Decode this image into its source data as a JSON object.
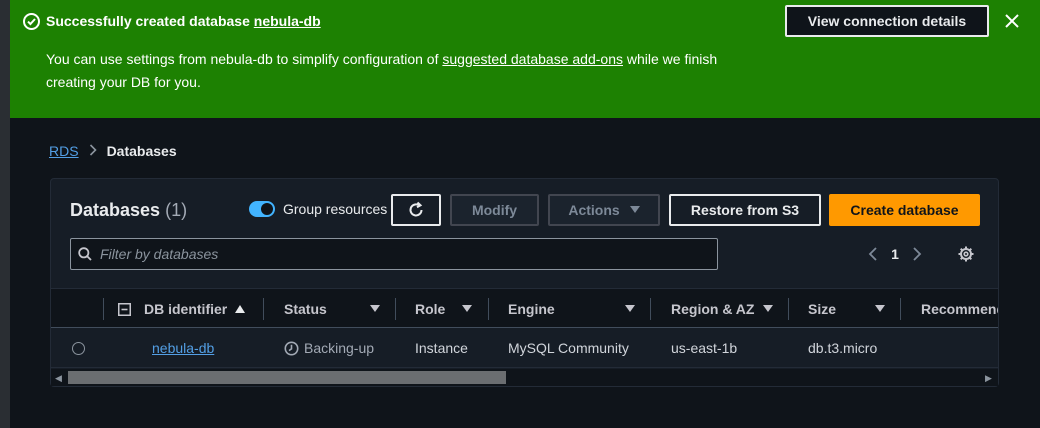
{
  "flash": {
    "title_prefix": "Successfully created database",
    "title_db": "nebula-db",
    "body_text_1": "You can use settings from nebula-db to simplify configuration of",
    "body_link": "suggested database add-ons",
    "body_text_2": "while we finish creating your DB for you.",
    "button_label": "View connection details",
    "icons": {
      "status": "check-circle-icon",
      "close": "close-icon"
    },
    "color": "#1d8102"
  },
  "breadcrumb": {
    "items": [
      {
        "label": "RDS"
      },
      {
        "label": "Databases"
      }
    ]
  },
  "panel": {
    "title": "Databases",
    "count": "(1)",
    "toggle": {
      "label": "Group resources",
      "on": true
    },
    "buttons": {
      "modify": "Modify",
      "actions": "Actions",
      "restore": "Restore from S3",
      "create": "Create database"
    },
    "filter": {
      "placeholder": "Filter by databases"
    },
    "pagination": {
      "page": "1"
    },
    "accent_color": "#ff9900"
  },
  "table": {
    "columns": [
      {
        "label": "DB identifier",
        "sorted": "ascending"
      },
      {
        "label": "Status"
      },
      {
        "label": "Role"
      },
      {
        "label": "Engine"
      },
      {
        "label": "Region & AZ"
      },
      {
        "label": "Size"
      },
      {
        "label": "Recommendations"
      }
    ],
    "rows": [
      {
        "db_identifier": "nebula-db",
        "status": "Backing-up",
        "role": "Instance",
        "engine": "MySQL Community",
        "region_az": "us-east-1b",
        "size": "db.t3.micro",
        "recommendations": ""
      }
    ]
  }
}
